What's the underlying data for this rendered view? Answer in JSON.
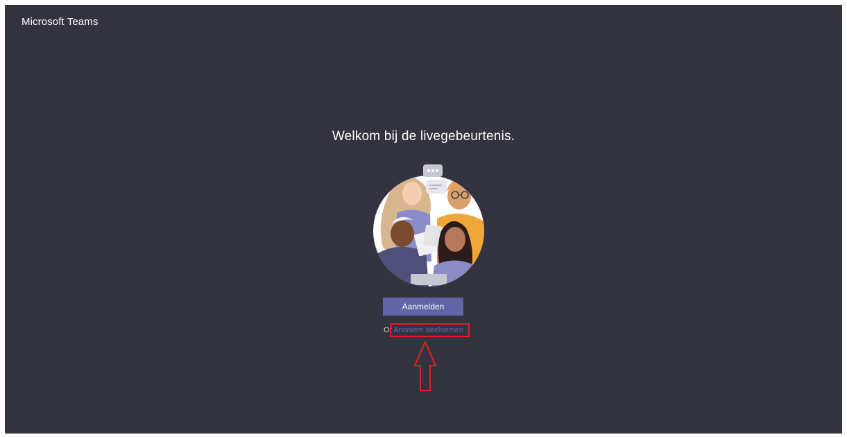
{
  "app": {
    "title": "Microsoft Teams"
  },
  "main": {
    "welcome_text": "Welkom bij de livegebeurtenis.",
    "illustration_icon": "people-group-illustration",
    "signin_label": "Aanmelden",
    "alt_prefix": "Of",
    "anonymous_link_label": "Anoniem deelnemen"
  },
  "annotation": {
    "highlight_color": "#e02020",
    "arrow_icon": "up-arrow-outline-icon"
  },
  "colors": {
    "background": "#33333f",
    "accent": "#6264a7",
    "text": "#ffffff"
  }
}
